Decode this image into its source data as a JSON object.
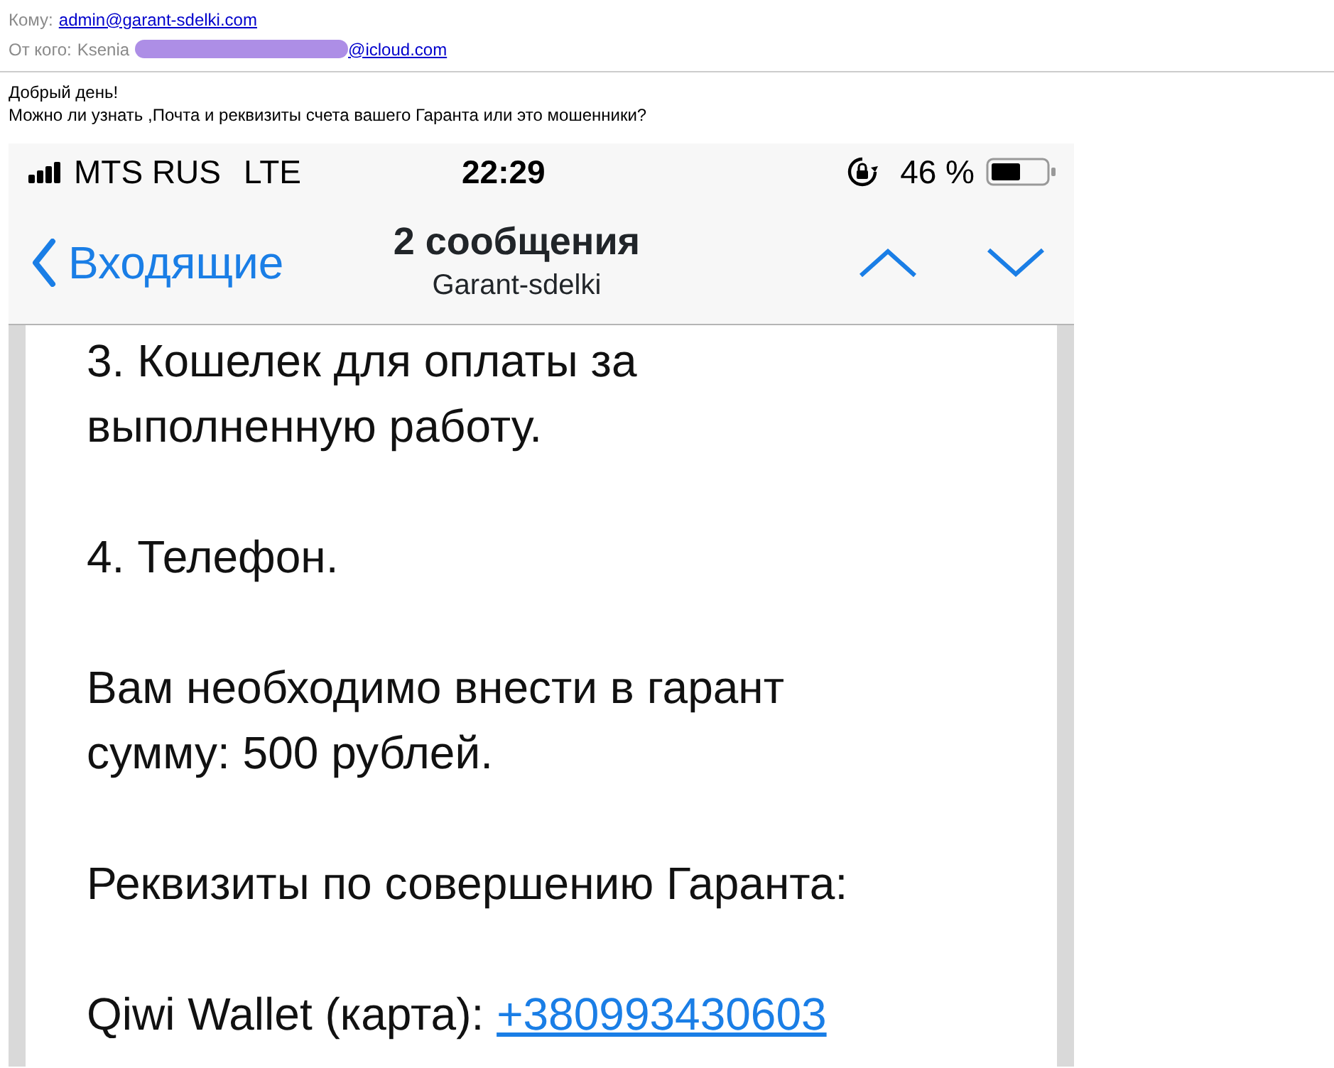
{
  "email": {
    "to_label": "Кому:",
    "to": "admin@garant-sdelki.com",
    "from_label": "От кого:",
    "from_name": "Ksenia",
    "from_address": "@icloud.com",
    "body": [
      "Добрый день!",
      "Можно ли узнать ,Почта и реквизиты счета вашего Гаранта или это мошенники?"
    ]
  },
  "phone": {
    "status_bar": {
      "carrier": "MTS RUS",
      "network": "LTE",
      "time": "22:29",
      "battery": "46 %"
    },
    "nav": {
      "back": "Входящие",
      "title": "2 сообщения",
      "subtitle": "Garant-sdelki"
    },
    "message": [
      {
        "kind": "text",
        "text": "3. Кошелек для оплаты за\nвыполненную работу."
      },
      {
        "kind": "text",
        "text": "4. Телефон."
      },
      {
        "kind": "text",
        "text": "Вам необходимо внести в гарант\nсумму: 500 рублей."
      },
      {
        "kind": "text",
        "text": "Реквизиты по совершению Гаранта:"
      },
      {
        "kind": "link",
        "text": "Qiwi Wallet (карта):",
        "link": "+380993430603"
      }
    ]
  }
}
